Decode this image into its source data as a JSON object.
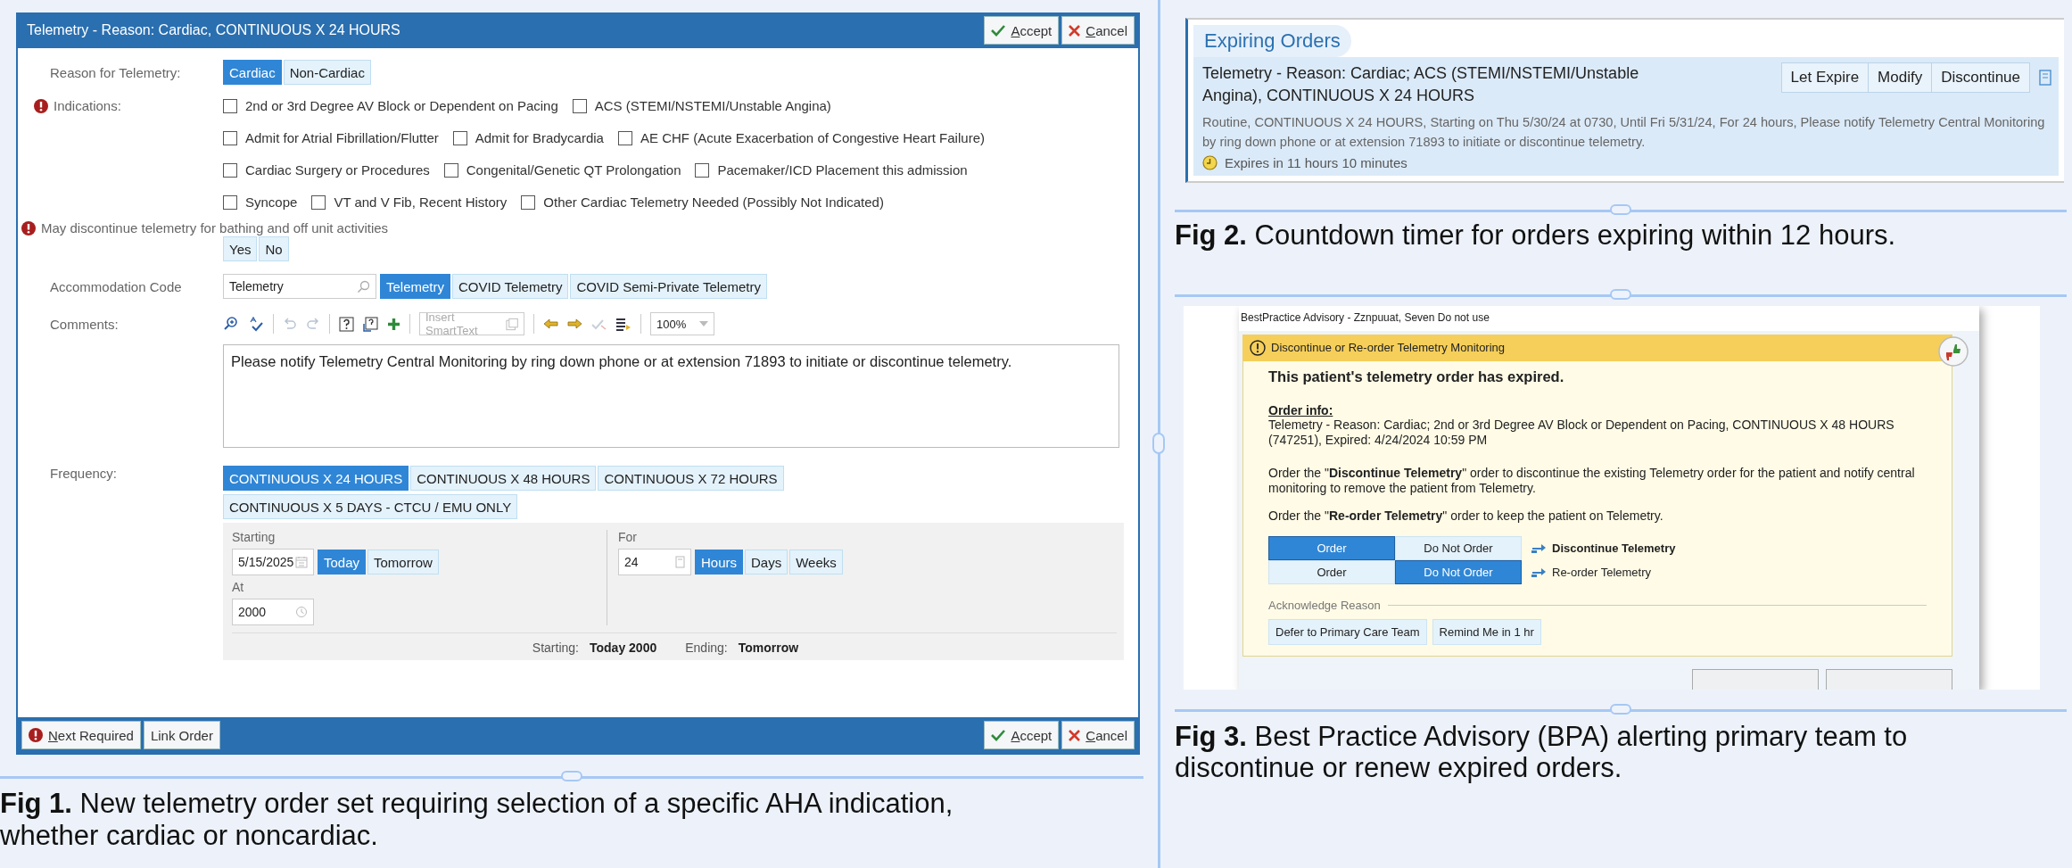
{
  "fig1": {
    "title": "Telemetry - Reason: Cardiac, CONTINUOUS X 24 HOURS",
    "header_buttons": [
      {
        "kind": "accept",
        "label": "Accept"
      },
      {
        "kind": "cancel",
        "label": "Cancel"
      }
    ],
    "reason": {
      "label": "Reason for Telemetry:",
      "options": [
        {
          "label": "Cardiac",
          "selected": true
        },
        {
          "label": "Non-Cardiac",
          "selected": false
        }
      ]
    },
    "indications": {
      "label": "Indications:",
      "required": true,
      "rows": [
        [
          {
            "label": "2nd or 3rd Degree AV Block or Dependent on Pacing",
            "checked": false
          },
          {
            "label": "ACS (STEMI/NSTEMI/Unstable Angina)",
            "checked": false
          }
        ],
        [
          {
            "label": "Admit for Atrial Fibrillation/Flutter",
            "checked": false
          },
          {
            "label": "Admit for Bradycardia",
            "checked": false
          },
          {
            "label": "AE CHF (Acute Exacerbation of Congestive Heart Failure)",
            "checked": false
          }
        ],
        [
          {
            "label": "Cardiac Surgery or Procedures",
            "checked": false
          },
          {
            "label": "Congenital/Genetic QT Prolongation",
            "checked": false
          },
          {
            "label": "Pacemaker/ICD Placement this admission",
            "checked": false
          }
        ],
        [
          {
            "label": "Syncope",
            "checked": false
          },
          {
            "label": "VT and V Fib, Recent History",
            "checked": false
          },
          {
            "label": "Other Cardiac Telemetry Needed (Possibly Not Indicated)",
            "checked": false
          }
        ]
      ]
    },
    "bathing": {
      "label": "May discontinue telemetry for bathing and off unit activities",
      "required": true,
      "options": [
        {
          "label": "Yes",
          "selected": false
        },
        {
          "label": "No",
          "selected": false
        }
      ]
    },
    "accommodation": {
      "label": "Accommodation Code",
      "value": "Telemetry",
      "options": [
        {
          "label": "Telemetry",
          "selected": true
        },
        {
          "label": "COVID Telemetry",
          "selected": false
        },
        {
          "label": "COVID Semi-Private Telemetry",
          "selected": false
        }
      ]
    },
    "comments": {
      "label": "Comments:",
      "smarttext_placeholder": "Insert SmartText",
      "zoom_value": "100%",
      "value": "Please notify Telemetry Central Monitoring by ring down phone or at extension 71893 to initiate or discontinue telemetry."
    },
    "frequency": {
      "label": "Frequency:",
      "options": [
        {
          "label": "CONTINUOUS X 24 HOURS",
          "selected": true
        },
        {
          "label": "CONTINUOUS X 48 HOURS",
          "selected": false
        },
        {
          "label": "CONTINUOUS X 72 HOURS",
          "selected": false
        },
        {
          "label": "CONTINUOUS X 5 DAYS - CTCU / EMU ONLY",
          "selected": false
        }
      ]
    },
    "schedule": {
      "starting_label": "Starting",
      "starting_value": "5/15/2025",
      "day_options": [
        {
          "label": "Today",
          "selected": true
        },
        {
          "label": "Tomorrow",
          "selected": false
        }
      ],
      "at_label": "At",
      "at_value": "2000",
      "for_label": "For",
      "for_value": "24",
      "unit_options": [
        {
          "label": "Hours",
          "selected": true
        },
        {
          "label": "Days",
          "selected": false
        },
        {
          "label": "Weeks",
          "selected": false
        }
      ],
      "summary": [
        {
          "label": "Starting:",
          "value": "Today 2000"
        },
        {
          "label": "Ending:",
          "value": "Tomorrow"
        }
      ]
    },
    "footer_buttons": [
      {
        "kind": "next",
        "label": "Next Required"
      },
      {
        "kind": "link",
        "label": "Link Order"
      }
    ],
    "footer_right_buttons": [
      {
        "kind": "accept",
        "label": "Accept"
      },
      {
        "kind": "cancel",
        "label": "Cancel"
      }
    ],
    "caption": "**Fig 1.** New telemetry order set requiring selection of a specific AHA indication,  whether cardiac or noncardiac."
  },
  "fig2": {
    "header": "Expiring Orders",
    "title": "Telemetry - Reason: Cardiac; ACS (STEMI/NSTEMI/Unstable Angina), CONTINUOUS X 24 HOURS",
    "actions": [
      "Let Expire",
      "Modify",
      "Discontinue"
    ],
    "details": "Routine, CONTINUOUS X 24 HOURS, Starting on Thu 5/30/24 at 0730, Until Fri 5/31/24, For 24 hours, Please notify Telemetry Central Monitoring by ring down phone or at extension 71893 to initiate or discontinue telemetry.",
    "timer": "Expires in 11 hours 10 minutes",
    "caption": "**Fig 2.** Countdown timer for orders expiring within 12 hours."
  },
  "fig3": {
    "window_title": "BestPractice Advisory - Zznpuuat, Seven Do not use",
    "banner": "Discontinue or Re-order Telemetry Monitoring",
    "headline": "This patient's telemetry order has expired.",
    "order_info_label": "Order info:",
    "order_info": "Telemetry - Reason:  Cardiac; 2nd or 3rd Degree AV Block or Dependent on Pacing, CONTINUOUS X 48 HOURS (747251), Expired: 4/24/2024 10:59 PM",
    "paragraphs": [
      "Order the \"**Discontinue Telemetry**\" order to discontinue the existing Telemetry order for the patient and notify central monitoring to remove the patient from Telemetry.",
      "Order the \"**Re-order Telemetry**\" order to keep the patient on Telemetry."
    ],
    "orders": [
      {
        "name": "Discontinue Telemetry",
        "choices": [
          {
            "label": "Order",
            "selected": true
          },
          {
            "label": "Do Not Order",
            "selected": false
          }
        ]
      },
      {
        "name": "Re-order Telemetry",
        "choices": [
          {
            "label": "Order",
            "selected": false
          },
          {
            "label": "Do Not Order",
            "selected": true
          }
        ]
      }
    ],
    "acknowledge_label": "Acknowledge Reason",
    "reasons": [
      "Defer to Primary Care Team",
      "Remind Me in 1 hr"
    ],
    "caption": "**Fig 3.** Best Practice Advisory (BPA) alerting primary team to discontinue or renew expired orders."
  }
}
